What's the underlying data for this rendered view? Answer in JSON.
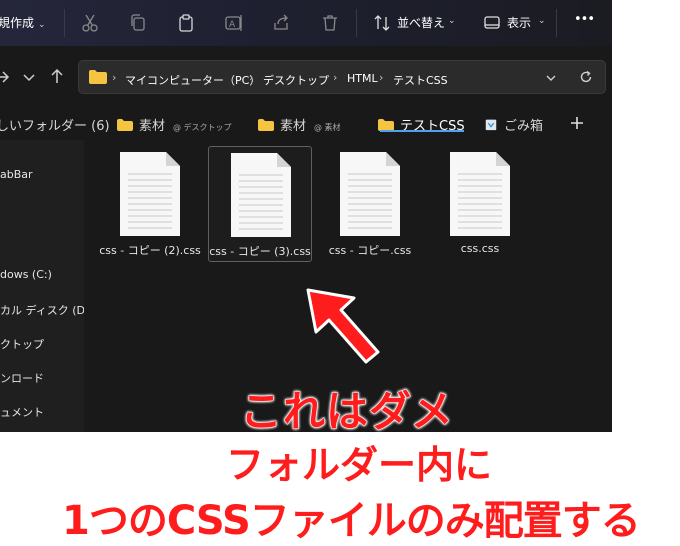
{
  "toolbar": {
    "new_label": "規作成",
    "sort_label": "並べ替え",
    "view_label": "表示",
    "more_label": "•••"
  },
  "address": {
    "crumbs": [
      "マイコンピューター（PC）",
      "デスクトップ",
      "HTML",
      "テストCSS"
    ]
  },
  "tabs": [
    {
      "label": "しいフォルダー (6)",
      "sub": ""
    },
    {
      "label": "素材",
      "sub": "@ デスクトップ"
    },
    {
      "label": "素材",
      "sub": "@ 素材"
    },
    {
      "label": "テストCSS",
      "sub": ""
    },
    {
      "label": "ごみ箱",
      "sub": ""
    }
  ],
  "sidebar": {
    "items": [
      "abBar",
      "dows (C:)",
      "カル ディスク (D:)",
      "クトップ",
      "ンロード",
      "ュメント"
    ]
  },
  "files": [
    {
      "name": "css - コピー (2).css",
      "selected": false
    },
    {
      "name": "css - コピー (3).css",
      "selected": true
    },
    {
      "name": "css - コピー.css",
      "selected": false
    },
    {
      "name": "css.css",
      "selected": false
    }
  ],
  "annotation": {
    "line1": "これはダメ",
    "line2": "フォルダー内に",
    "line3": "1つのCSSファイルのみ配置する",
    "color": "#ff1c1c"
  },
  "colors": {
    "window_bg": "#191919",
    "folder": "#f5c542",
    "accent": "#4fa0f0"
  }
}
